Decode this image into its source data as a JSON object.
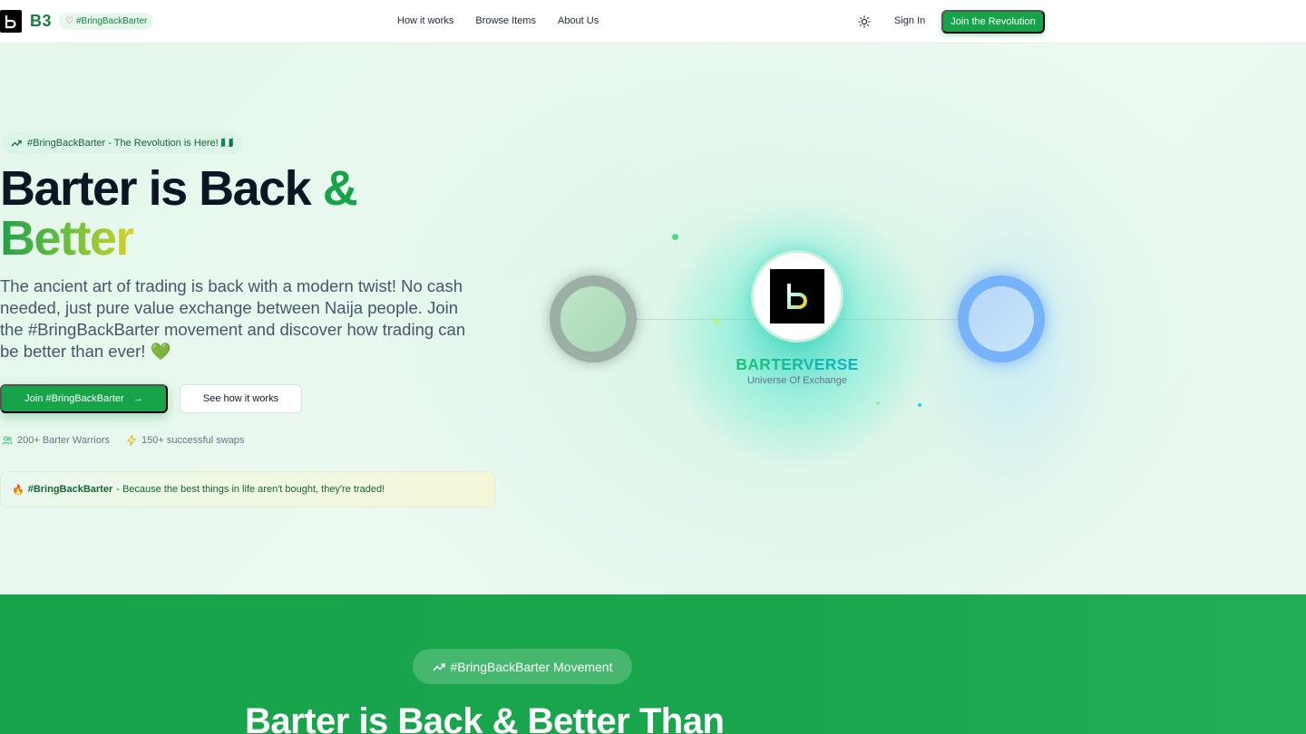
{
  "nav": {
    "brand": "B3",
    "hashtag": "#BringBackBarter",
    "links": [
      "How it works",
      "Browse Items",
      "About Us"
    ],
    "sign_in": "Sign In",
    "cta": "Join the Revolution"
  },
  "hero": {
    "tag": "#BringBackBarter - The Revolution is Here! 🇳🇬",
    "title_part1": "Barter is Back",
    "title_amp": "&",
    "title_part2": "Better",
    "lead": "The ancient art of trading is back with a modern twist! No cash needed, just pure value exchange between Naija people. Join the #BringBackBarter movement and discover how trading can be better than ever! 💚",
    "join_button": "Join #BringBackBarter",
    "see_button": "See how it works",
    "stat_users": "200+ Barter Warriors",
    "stat_swaps": "150+ successful swaps",
    "quote_emoji": "🔥",
    "quote_bold": "#BringBackBarter",
    "quote_text": "- Because the best things in life aren't bought, they're traded!"
  },
  "visual": {
    "title": "BARTERVERSE",
    "subtitle": "Universe Of Exchange"
  },
  "movement": {
    "pill": "#BringBackBarter Movement",
    "heading": "Barter is Back & Better Than"
  },
  "colors": {
    "brand_green": "#16a34a",
    "accent_teal": "#14b8a6",
    "accent_blue": "#60a5fa"
  }
}
